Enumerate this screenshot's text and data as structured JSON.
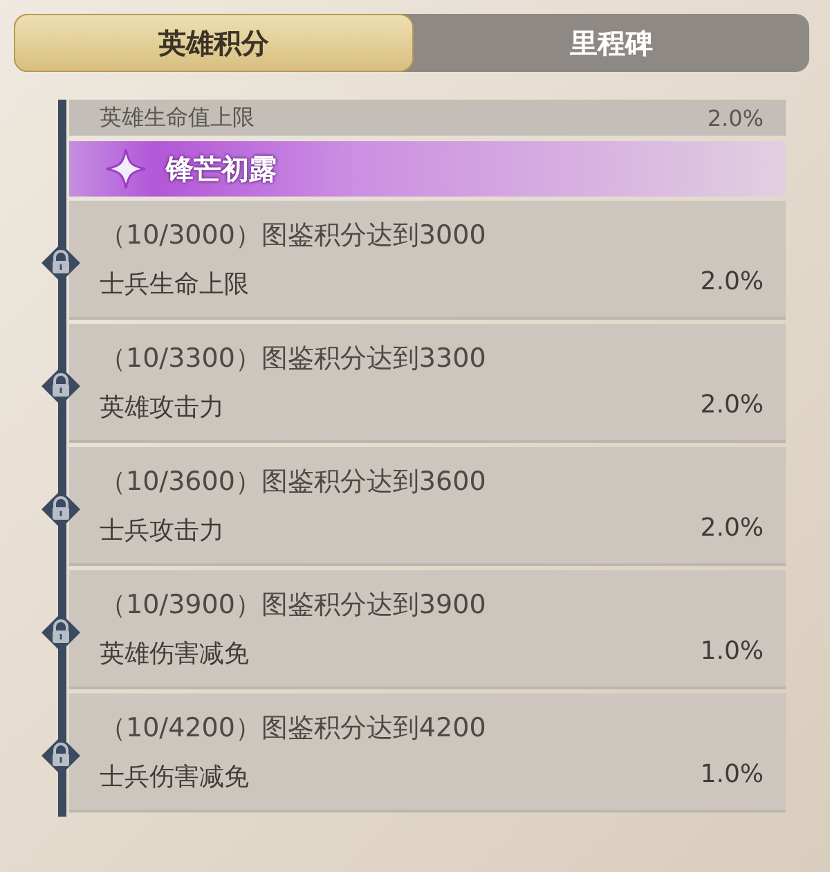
{
  "tabs": [
    {
      "label": "英雄积分",
      "selected": true
    },
    {
      "label": "里程碑",
      "selected": false
    }
  ],
  "previous_row": {
    "name": "英雄生命值上限",
    "value": "2.0%"
  },
  "section": {
    "title": "锋芒初露"
  },
  "milestones": [
    {
      "condition": "（10/3000）图鉴积分达到3000",
      "name": "士兵生命上限",
      "value": "2.0%",
      "locked": true
    },
    {
      "condition": "（10/3300）图鉴积分达到3300",
      "name": "英雄攻击力",
      "value": "2.0%",
      "locked": true
    },
    {
      "condition": "（10/3600）图鉴积分达到3600",
      "name": "士兵攻击力",
      "value": "2.0%",
      "locked": true
    },
    {
      "condition": "（10/3900）图鉴积分达到3900",
      "name": "英雄伤害减免",
      "value": "1.0%",
      "locked": true
    },
    {
      "condition": "（10/4200）图鉴积分达到4200",
      "name": "士兵伤害减免",
      "value": "1.0%",
      "locked": true
    }
  ]
}
